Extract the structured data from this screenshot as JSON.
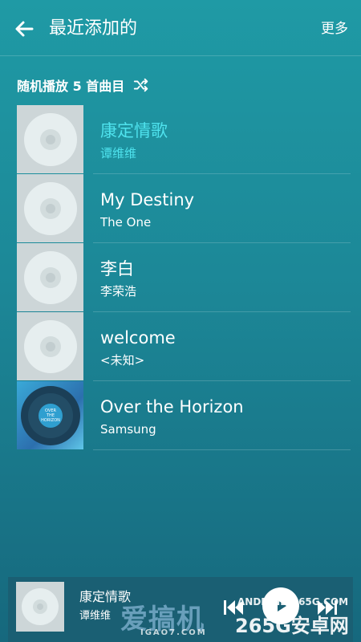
{
  "header": {
    "title": "最近添加的",
    "more_label": "更多"
  },
  "shuffle": {
    "label": "随机播放 5 首曲目"
  },
  "songs": [
    {
      "title": "康定情歌",
      "artist": "谭维维",
      "active": true,
      "art": "disc"
    },
    {
      "title": "My Destiny",
      "artist": "The One",
      "active": false,
      "art": "disc"
    },
    {
      "title": "李白",
      "artist": "李荣浩",
      "active": false,
      "art": "disc"
    },
    {
      "title": "welcome",
      "artist": "<未知>",
      "active": false,
      "art": "disc"
    },
    {
      "title": "Over the Horizon",
      "artist": "Samsung",
      "active": false,
      "art": "album-over-the-horizon"
    }
  ],
  "album_art_text": [
    "OVER",
    "THE",
    "HORIZON"
  ],
  "now_playing": {
    "title": "康定情歌",
    "artist": "谭维维",
    "state": "paused"
  },
  "watermarks": {
    "brand_cn": "爱搞机",
    "site_en": "ANDROID.265G.COM",
    "site_cn": "265G安卓网",
    "site_igao": "IGAO7.COM"
  },
  "colors": {
    "background_top": "#1f9aa5",
    "background_bottom": "#16687d",
    "accent_active": "#4fe3ee",
    "thumb_placeholder": "#cdd6d8"
  },
  "icons": {
    "back": "arrow-left-icon",
    "shuffle": "shuffle-icon",
    "disc": "cd-disc-icon",
    "prev": "skip-previous-icon",
    "play": "play-icon",
    "next": "skip-next-icon"
  }
}
